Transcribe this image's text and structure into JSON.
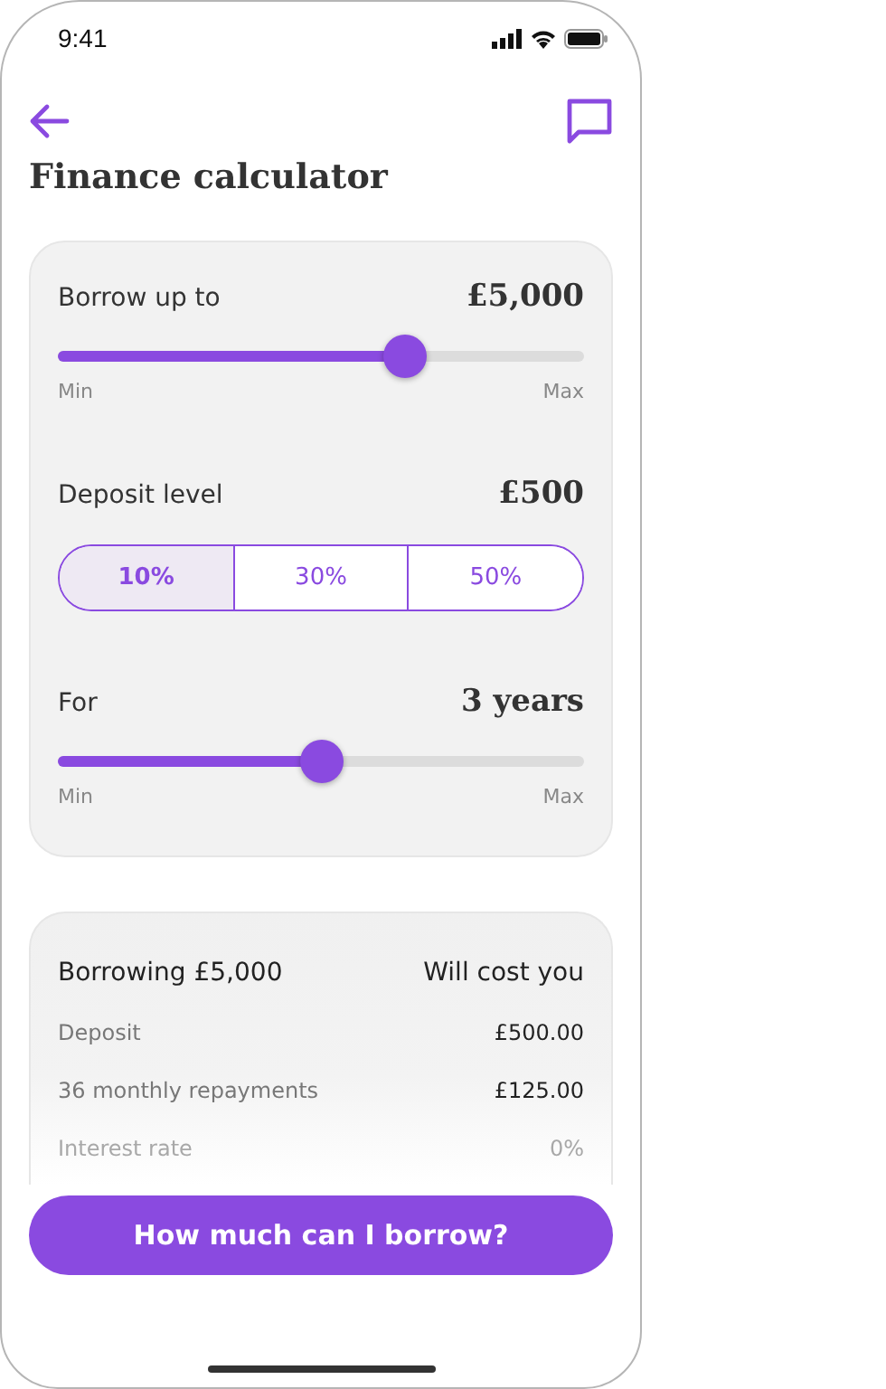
{
  "status_bar": {
    "time": "9:41"
  },
  "header": {
    "title": "Finance calculator"
  },
  "calculator": {
    "borrow": {
      "label": "Borrow up to",
      "value": "£5,000",
      "level": 0.66,
      "min_label": "Min",
      "max_label": "Max"
    },
    "deposit": {
      "label": "Deposit level",
      "value": "£500",
      "options": [
        {
          "label": "10%",
          "selected": true
        },
        {
          "label": "30%",
          "selected": false
        },
        {
          "label": "50%",
          "selected": false
        }
      ]
    },
    "term": {
      "label": "For",
      "value": "3 years",
      "level": 0.5,
      "min_label": "Min",
      "max_label": "Max"
    }
  },
  "summary": {
    "heading": "Borrowing £5,000",
    "heading_right": "Will cost you",
    "rows": [
      {
        "label": "Deposit",
        "value": "£500.00",
        "faded": false
      },
      {
        "label": "36 monthly repayments",
        "value": "£125.00",
        "faded": false
      },
      {
        "label": "Interest rate",
        "value": "0%",
        "faded": true
      }
    ]
  },
  "action_button": "How much can I borrow?"
}
